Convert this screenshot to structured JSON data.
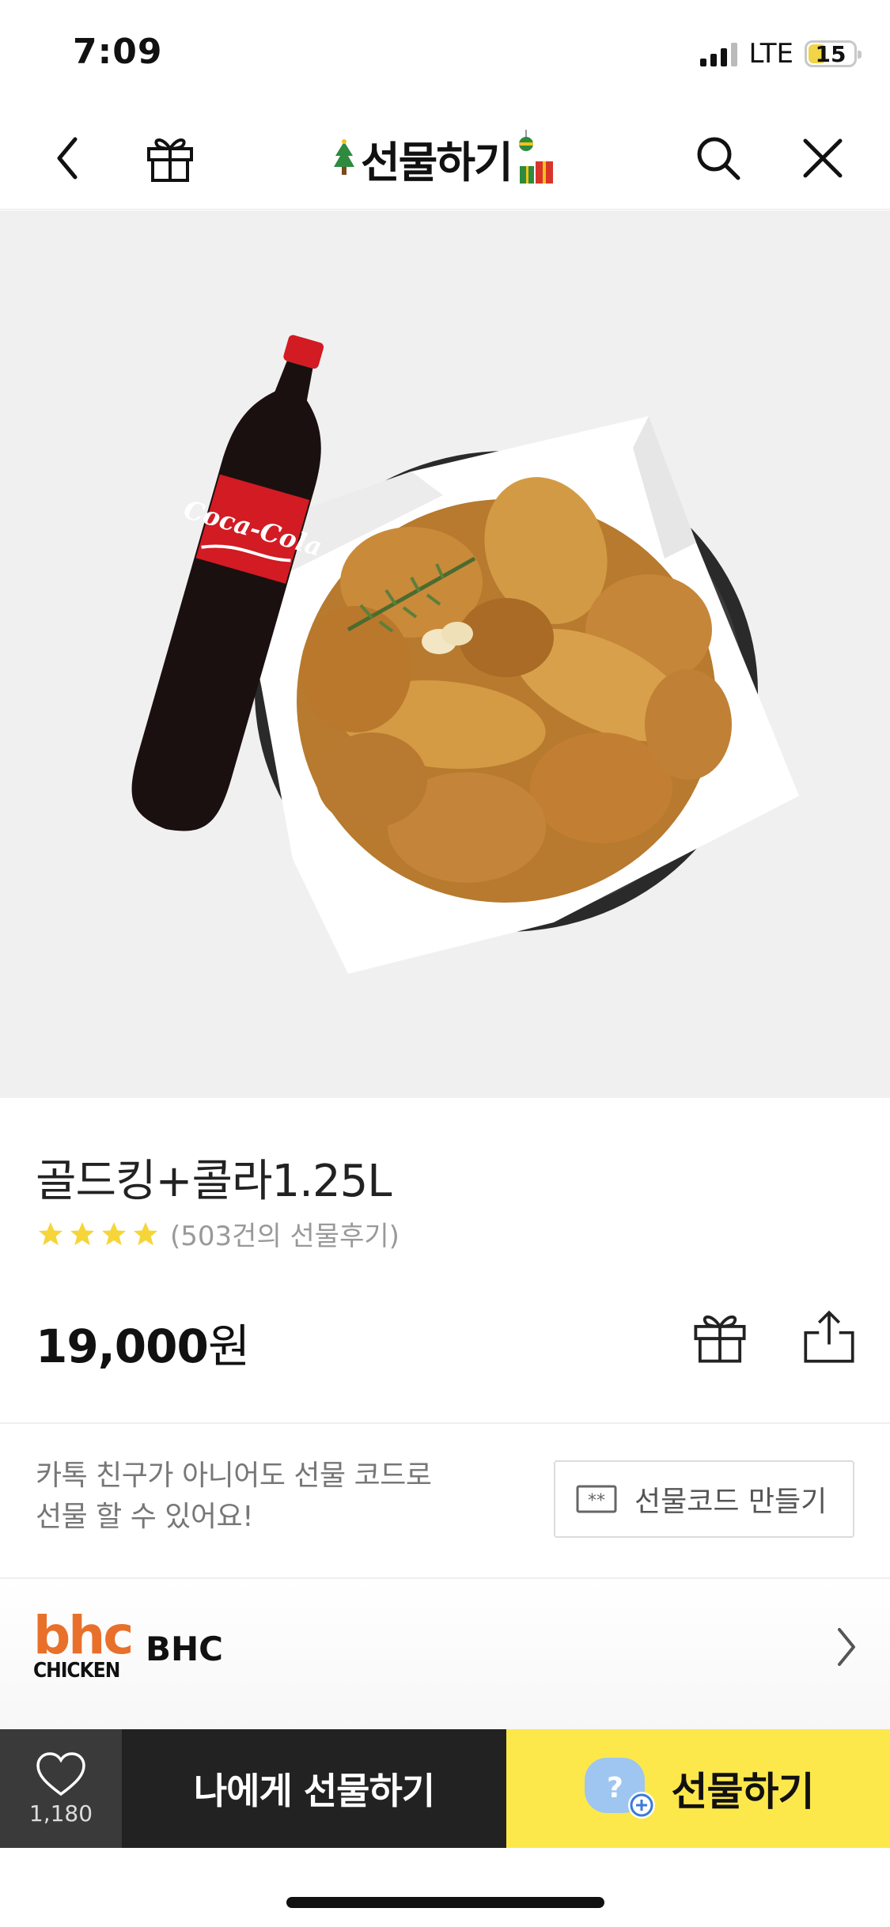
{
  "status": {
    "time": "7:09",
    "network": "LTE",
    "battery": "15"
  },
  "nav": {
    "title": "선물하기"
  },
  "product": {
    "name": "골드킹+콜라1.25L",
    "rating_stars": 4,
    "review_count": "(503건의 선물후기)",
    "price": "19,000",
    "currency": "원"
  },
  "gift_code": {
    "line1": "카톡 친구가 아니어도 선물 코드로",
    "line2": "선물 할 수 있어요!",
    "button_label": "선물코드 만들기",
    "button_icon_text": "**"
  },
  "brand": {
    "logo_top": "bhc",
    "logo_bottom": "CHICKEN",
    "name": "BHC"
  },
  "bottom_bar": {
    "like_count": "1,180",
    "self_gift_label": "나에게 선물하기",
    "gift_label": "선물하기"
  },
  "hero": {
    "bottle_label": "Coca-Cola"
  },
  "colors": {
    "accent_yellow": "#fde84b",
    "dark": "#222222",
    "brand_orange": "#e8702a",
    "star": "#f5d53a"
  }
}
